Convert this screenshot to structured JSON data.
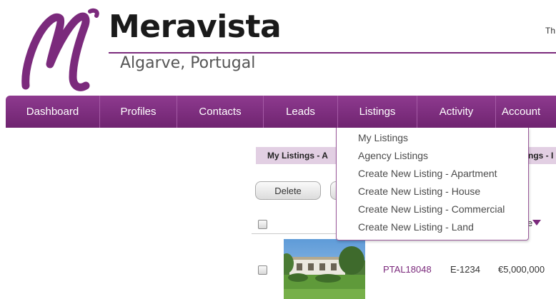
{
  "brand": {
    "name": "Meravista",
    "location": "Algarve, Portugal",
    "top_right_text": "Th",
    "accent_color": "#7b2a7c"
  },
  "nav": {
    "items": [
      {
        "label": "Dashboard"
      },
      {
        "label": "Profiles"
      },
      {
        "label": "Contacts"
      },
      {
        "label": "Leads"
      },
      {
        "label": "Listings"
      },
      {
        "label": "Activity"
      },
      {
        "label": "Account"
      }
    ]
  },
  "listings_menu": {
    "items": [
      {
        "label": "My Listings"
      },
      {
        "label": "Agency Listings"
      },
      {
        "label": "Create New Listing - Apartment"
      },
      {
        "label": "Create New Listing - House"
      },
      {
        "label": "Create New Listing - Commercial"
      },
      {
        "label": "Create New Listing - Land"
      }
    ]
  },
  "tabs": [
    {
      "label": "My Listings - A"
    },
    {
      "label": "ngs - I"
    }
  ],
  "toolbar": {
    "delete_label": "Delete"
  },
  "table": {
    "sort_label": "e",
    "rows": [
      {
        "ref": "PTAL18048",
        "code": "E-1234",
        "price": "€5,000,000"
      }
    ]
  }
}
